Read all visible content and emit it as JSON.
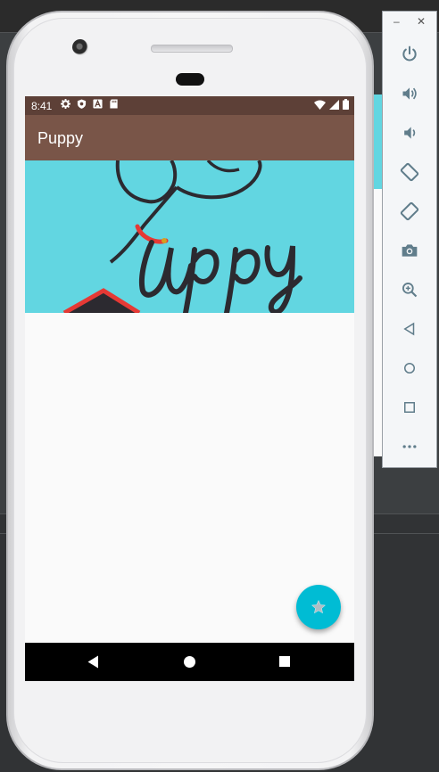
{
  "status_bar": {
    "time": "8:41",
    "left_icons": [
      "gear-icon",
      "shield-icon",
      "a-icon",
      "sd-card-icon"
    ],
    "right_icons": [
      "wifi-icon",
      "signal-icon",
      "battery-icon"
    ]
  },
  "app_bar": {
    "title": "Puppy"
  },
  "hero": {
    "logo_text": "Puppy",
    "background_color": "#62d6e1"
  },
  "fab": {
    "icon": "star-icon",
    "color": "#00bcd4"
  },
  "nav_bar": {
    "buttons": [
      "back-icon",
      "home-icon",
      "recents-icon"
    ]
  },
  "emulator_controls": {
    "window_buttons": [
      "minimize-icon",
      "close-icon"
    ],
    "items": [
      "power-icon",
      "volume-up-icon",
      "volume-down-icon",
      "rotate-left-icon",
      "rotate-right-icon",
      "camera-icon",
      "zoom-icon",
      "back-icon",
      "home-icon",
      "overview-icon",
      "more-icon"
    ]
  },
  "colors": {
    "status_bar": "#5d4037",
    "app_bar": "#795548",
    "accent": "#00bcd4"
  }
}
